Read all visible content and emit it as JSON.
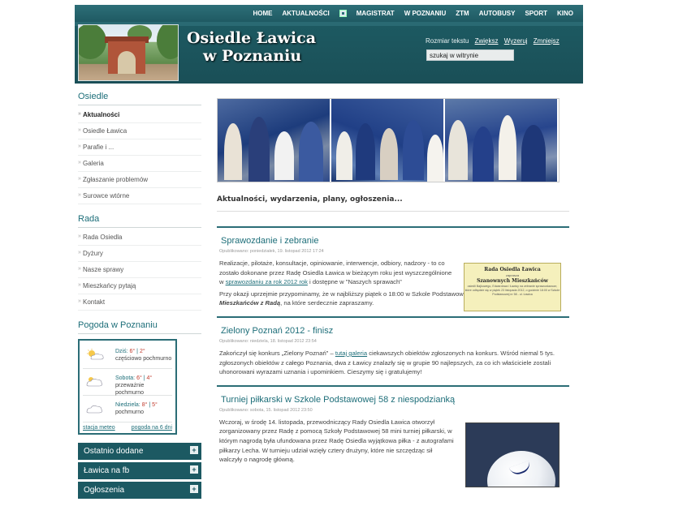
{
  "topnav": {
    "items": [
      "HOME",
      "AKTUALNOŚCI",
      "MAGISTRAT",
      "W POZNANIU",
      "ZTM",
      "AUTOBUSY",
      "SPORT",
      "KINO"
    ]
  },
  "header": {
    "title_line1": "Osiedle Ławica",
    "title_line2": "w Poznaniu",
    "textsize_label": "Rozmiar tekstu",
    "textsize_bigger": "Zwiększ",
    "textsize_reset": "Wyzeruj",
    "textsize_smaller": "Zmniejsz",
    "search_value": "szukaj w witrynie"
  },
  "sidebar": {
    "osiedle_heading": "Osiedle",
    "osiedle_items": [
      "Aktualności",
      "Osiedle Ławica",
      "Parafie i ...",
      "Galeria",
      "Zgłaszanie problemów",
      "Surowce wtórne"
    ],
    "rada_heading": "Rada",
    "rada_items": [
      "Rada Osiedla",
      "Dyżury",
      "Nasze sprawy",
      "Mieszkańcy pytają",
      "Kontakt"
    ],
    "weather_heading": "Pogoda w Poznaniu",
    "weather": [
      {
        "day": "Dziś:",
        "hi": "6°",
        "lo": "2°",
        "desc": "częściowo pochmurno",
        "icon": "partly-cloudy-icon"
      },
      {
        "day": "Sobota:",
        "hi": "6°",
        "lo": "4°",
        "desc": "przeważnie pochmurno",
        "icon": "mostly-cloudy-icon"
      },
      {
        "day": "Niedziela:",
        "hi": "8°",
        "lo": "5°",
        "desc": "pochmurno",
        "icon": "cloudy-icon"
      }
    ],
    "weather_link_station": "stacja meteo",
    "weather_link_forecast": "pogoda na 6 dni",
    "accordion": [
      "Ostatnio dodane",
      "Ławica na fb",
      "Ogłoszenia"
    ]
  },
  "main": {
    "section_title": "Aktualności, wydarzenia, plany, ogłoszenia...",
    "articles": [
      {
        "title": "Sprawozdanie i zebranie",
        "meta": "Opublikowano: poniedziałek, 19. listopad 2012 17:24",
        "p1_a": "Realizacje, pilotaże, konsultacje, opiniowanie, interwencje, odbiory, nadzory - to co zostało dokonane przez Radę Osiedla Ławica w bieżącym roku jest wyszczególnione w ",
        "p1_link": "sprawozdaniu za rok 2012 rok",
        "p1_b": " i dostępne w \"Naszych sprawach\"",
        "p2_a": "Przy okazji uprzejmie przypominamy, że w najbliższy piątek o 18:00 w Szkole Podstawowej nr 58 odbędzie się ",
        "p2_em": "spotkanie Mieszkańców z Radą",
        "p2_b": ", na które serdecznie zapraszamy.",
        "poster_l1": "Rada Osiedla Ławica",
        "poster_l2": "zaprasza",
        "poster_l3": "Szanownych Mieszkańców",
        "poster_l4": "osiedli Bajkowego, Edwardowa i Ławicy na zebranie sprawozdawcze, które odbędzie się w piątek 23 listopada 2012, o godzinie 18:00 w Szkole Podstawowej nr 58 - ul. Ławica"
      },
      {
        "title": "Zielony Poznań 2012 - finisz",
        "meta": "Opublikowano: niedziela, 18. listopad 2012 23:54",
        "p1_a": "Zakończył się konkurs „Zielony Poznań\" – ",
        "p1_link": "tutaj galeria",
        "p1_b": " ciekawszych obiektów zgłoszonych na konkurs. Wśród niemal 5 tys. zgłoszonych obiektów z całego Poznania, dwa z Ławicy znalazły się w grupie 90 najlepszych, za co ich właściciele zostali uhonorowani wyrazami uznania i upominkiem. Cieszymy się i gratulujemy!"
      },
      {
        "title": "Turniej piłkarski w Szkole Podstawowej 58 z niespodzianką",
        "meta": "Opublikowano: sobota, 15. listopad 2012 23:50",
        "p1": "Wczoraj, w środę 14. listopada, przewodniczący Rady Osiedla Ławica otworzył zorganizowany przez Radę z pomocą Szkoły Podstawowej 58 mini turniej piłkarski, w którym nagrodą była ufundowana przez Radę Osiedla wyjątkowa piłka - z autografami piłkarzy Lecha. W turnieju udział wzięły cztery drużyny, które nie szczędząc sił walczyły o nagrodę główną."
      }
    ]
  }
}
